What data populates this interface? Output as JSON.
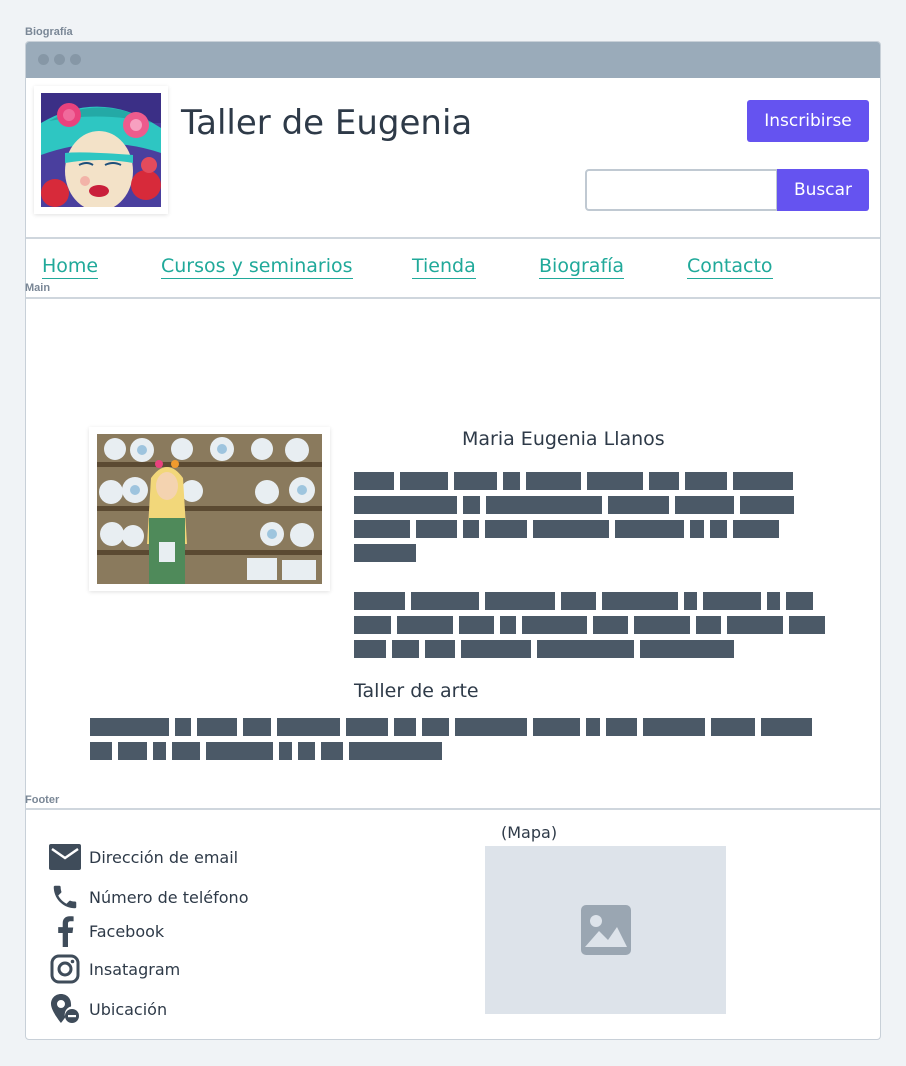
{
  "sections": {
    "biografia": "Biografía",
    "main": "Main",
    "footer": "Footer"
  },
  "header": {
    "title": "Taller de Eugenia",
    "signup_label": "Inscribirse",
    "search_placeholder": "",
    "search_button": "Buscar"
  },
  "nav": {
    "items": [
      {
        "label": "Home"
      },
      {
        "label": "Cursos y seminarios"
      },
      {
        "label": "Tienda"
      },
      {
        "label": "Biografía"
      },
      {
        "label": "Contacto"
      }
    ]
  },
  "main": {
    "name_heading": "Maria Eugenia Llanos",
    "subheading": "Taller de arte"
  },
  "footer": {
    "contacts": [
      {
        "icon": "email-icon",
        "label": "Dirección de email"
      },
      {
        "icon": "phone-icon",
        "label": "Número de teléfono"
      },
      {
        "icon": "facebook-icon",
        "label": "Facebook"
      },
      {
        "icon": "instagram-icon",
        "label": "Insatagram"
      },
      {
        "icon": "location-icon",
        "label": "Ubicación"
      }
    ],
    "map_label": "(Mapa)"
  },
  "colors": {
    "accent": "#6553f0",
    "link": "#20a99a",
    "text": "#2e3a48",
    "placeholder_text": "#4b5967",
    "titlebar": "#9aabba"
  }
}
